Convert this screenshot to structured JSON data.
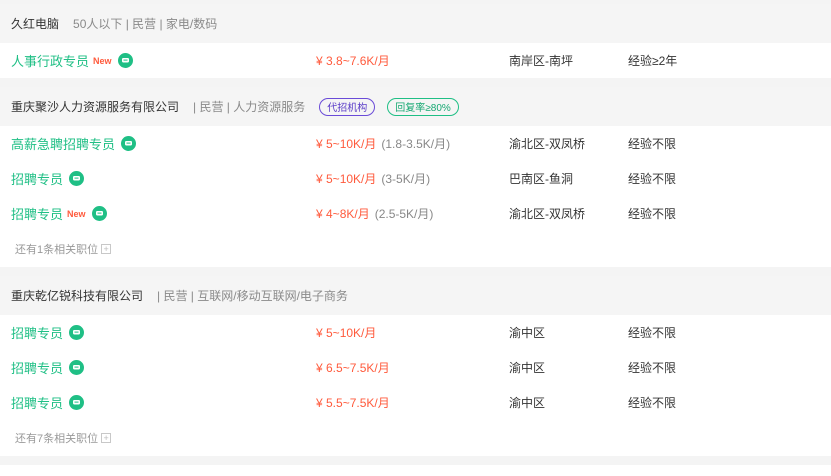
{
  "companies": [
    {
      "name": "久红电脑",
      "meta": "50人以下 | 民营 | 家电/数码",
      "tags": [],
      "jobs": [
        {
          "title": "人事行政专员",
          "new_badge": "New",
          "salary": "¥ 3.8~7.6K/月",
          "salary_detail": "",
          "location": "南岸区-南坪",
          "experience": "经验≥2年"
        }
      ],
      "more": ""
    },
    {
      "name": "重庆聚沙人力资源服务有限公司",
      "meta": "| 民营 | 人力资源服务",
      "tags": [
        "代招机构",
        "回复率≥80%"
      ],
      "jobs": [
        {
          "title": "高薪急聘招聘专员",
          "new_badge": "",
          "salary": "¥ 5~10K/月",
          "salary_detail": "(1.8-3.5K/月)",
          "location": "渝北区-双凤桥",
          "experience": "经验不限"
        },
        {
          "title": "招聘专员",
          "new_badge": "",
          "salary": "¥ 5~10K/月",
          "salary_detail": "(3-5K/月)",
          "location": "巴南区-鱼洞",
          "experience": "经验不限"
        },
        {
          "title": "招聘专员",
          "new_badge": "New",
          "salary": "¥ 4~8K/月",
          "salary_detail": "(2.5-5K/月)",
          "location": "渝北区-双凤桥",
          "experience": "经验不限"
        }
      ],
      "more": "还有1条相关职位"
    },
    {
      "name": "重庆乾亿锐科技有限公司",
      "meta": "| 民营 | 互联网/移动互联网/电子商务",
      "tags": [],
      "jobs": [
        {
          "title": "招聘专员",
          "new_badge": "",
          "salary": "¥ 5~10K/月",
          "salary_detail": "",
          "location": "渝中区",
          "experience": "经验不限"
        },
        {
          "title": "招聘专员",
          "new_badge": "",
          "salary": "¥ 6.5~7.5K/月",
          "salary_detail": "",
          "location": "渝中区",
          "experience": "经验不限"
        },
        {
          "title": "招聘专员",
          "new_badge": "",
          "salary": "¥ 5.5~7.5K/月",
          "salary_detail": "",
          "location": "渝中区",
          "experience": "经验不限"
        }
      ],
      "more": "还有7条相关职位"
    }
  ],
  "icons": {
    "chat": "chat-bubble-icon",
    "expand": "plus-square-icon"
  },
  "colors": {
    "accent_green": "#1fbf85",
    "salary_red": "#ff5a3c",
    "tag_purple": "#5a3cc8",
    "header_bg": "#f5f5f5"
  }
}
